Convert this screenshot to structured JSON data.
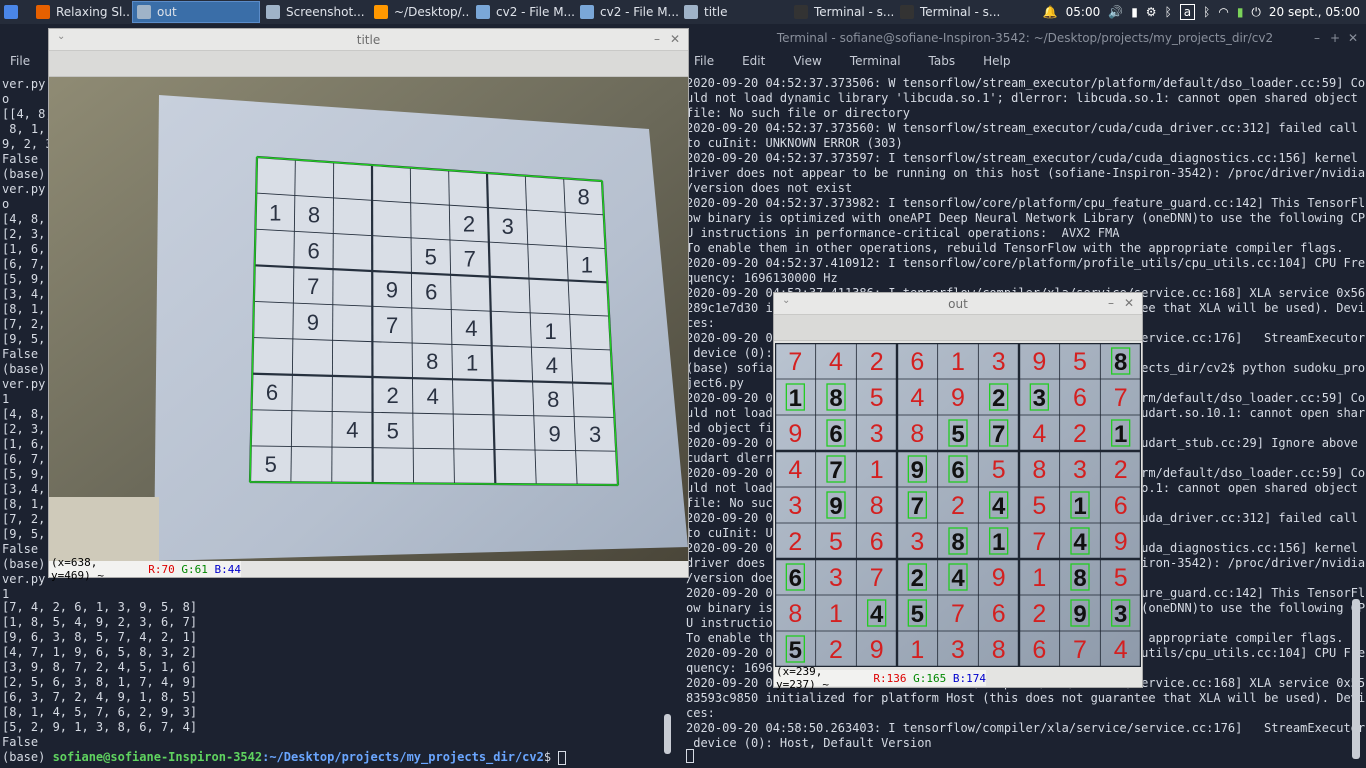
{
  "taskbar": {
    "tasks": [
      {
        "label": "",
        "icon": "app-menu-icon"
      },
      {
        "label": "Relaxing Sl...",
        "icon": "firefox-icon"
      },
      {
        "label": "out",
        "icon": "window-icon",
        "active": true
      },
      {
        "label": "Screenshot...",
        "icon": "window-icon"
      },
      {
        "label": "~/Desktop/...",
        "icon": "sublime-icon"
      },
      {
        "label": "cv2 - File M...",
        "icon": "folder-icon"
      },
      {
        "label": "cv2 - File M...",
        "icon": "folder-icon"
      },
      {
        "label": "title",
        "icon": "window-icon"
      },
      {
        "label": "Terminal - s...",
        "icon": "terminal-icon"
      },
      {
        "label": "Terminal - s...",
        "icon": "terminal-icon"
      }
    ],
    "time": "05:00",
    "date": "20 sept., 05:00"
  },
  "left_terminal": {
    "menu": [
      "File"
    ],
    "top_lines": [
      "ver.py",
      "o",
      "[[4, 8,",
      " 8, 1,",
      "9, 2, 3",
      "False",
      "(base)",
      "ver.py",
      "o",
      "[4, 8,",
      "[2, 3,",
      "[1, 6,",
      "[6, 7,",
      "[5, 9,",
      "[3, 4,",
      "[8, 1,",
      "[7, 2,",
      "[9, 5,",
      "False",
      "(base)",
      "ver.py",
      "1",
      "[4, 8,",
      "[2, 3,",
      "[1, 6,",
      "[6, 7,",
      "[5, 9,",
      "[3, 4,",
      "[8, 1,",
      "[7, 2,",
      "[9, 5,",
      "False",
      "(base)",
      "ver.py",
      "1"
    ],
    "bottom_lines": [
      "[7, 4, 2, 6, 1, 3, 9, 5, 8]",
      "[1, 8, 5, 4, 9, 2, 3, 6, 7]",
      "[9, 6, 3, 8, 5, 7, 4, 2, 1]",
      "[4, 7, 1, 9, 6, 5, 8, 3, 2]",
      "[3, 9, 8, 7, 2, 4, 5, 1, 6]",
      "[2, 5, 6, 3, 8, 1, 7, 4, 9]",
      "[6, 3, 7, 2, 4, 9, 1, 8, 5]",
      "[8, 1, 4, 5, 7, 6, 2, 9, 3]",
      "[5, 2, 9, 1, 3, 8, 6, 7, 4]",
      "False"
    ],
    "prompt_prefix": "(base) ",
    "prompt_user": "sofiane@sofiane-Inspiron-3542",
    "prompt_path": ":~/Desktop/projects/my_projects_dir/cv2",
    "prompt_suffix": "$ "
  },
  "title_window": {
    "title": "title",
    "status": {
      "coords": "(x=638, y=469) ~",
      "r": "R:70",
      "g": "G:61",
      "b": "B:44"
    },
    "puzzle": [
      [
        "",
        "",
        "",
        "",
        "",
        "",
        "",
        "",
        "8"
      ],
      [
        "1",
        "8",
        "",
        "",
        "",
        "2",
        "3",
        "",
        ""
      ],
      [
        "",
        "6",
        "",
        "",
        "5",
        "7",
        "",
        "",
        "1"
      ],
      [
        "",
        "7",
        "",
        "9",
        "6",
        "",
        "",
        "",
        ""
      ],
      [
        "",
        "9",
        "",
        "7",
        "",
        "4",
        "",
        "1",
        ""
      ],
      [
        "",
        "",
        "",
        "",
        "8",
        "1",
        "",
        "4",
        ""
      ],
      [
        "6",
        "",
        "",
        "2",
        "4",
        "",
        "",
        "8",
        ""
      ],
      [
        "",
        "",
        "4",
        "5",
        "",
        "",
        "",
        "9",
        "3"
      ],
      [
        "5",
        "",
        "",
        "",
        "",
        "",
        "",
        "",
        ""
      ]
    ]
  },
  "right_terminal": {
    "title": "Terminal - sofiane@sofiane-Inspiron-3542: ~/Desktop/projects/my_projects_dir/cv2",
    "menu": [
      "File",
      "Edit",
      "View",
      "Terminal",
      "Tabs",
      "Help"
    ],
    "lines": [
      "2020-09-20 04:52:37.373506: W tensorflow/stream_executor/platform/default/dso_loader.cc:59] Co",
      "uld not load dynamic library 'libcuda.so.1'; dlerror: libcuda.so.1: cannot open shared object",
      "file: No such file or directory",
      "2020-09-20 04:52:37.373560: W tensorflow/stream_executor/cuda/cuda_driver.cc:312] failed call",
      "to cuInit: UNKNOWN ERROR (303)",
      "2020-09-20 04:52:37.373597: I tensorflow/stream_executor/cuda/cuda_diagnostics.cc:156] kernel",
      "driver does not appear to be running on this host (sofiane-Inspiron-3542): /proc/driver/nvidia",
      "/version does not exist",
      "2020-09-20 04:52:37.373982: I tensorflow/core/platform/cpu_feature_guard.cc:142] This TensorFl",
      "ow binary is optimized with oneAPI Deep Neural Network Library (oneDNN)to use the following CP",
      "U instructions in performance-critical operations:  AVX2 FMA",
      "To enable them in other operations, rebuild TensorFlow with the appropriate compiler flags.",
      "2020-09-20 04:52:37.410912: I tensorflow/core/platform/profile_utils/cpu_utils.cc:104] CPU Fre",
      "quency: 1696130000 Hz",
      "2020-09-20 04:52:37.411386: I tensorflow/compiler/xla/service/service.cc:168] XLA service 0x56",
      "289c1e7d30 initialized for platform Host (this does not guarantee that XLA will be used). Devi",
      "ces:",
      "2020-09-20 04:52:37.411402: I tensorflow/compiler/xla/service/service.cc:176]   StreamExecutor",
      " device (0): Host, Default Version",
      "(base) sofiane@sofiane-Inspiron-3542:~/Desktop/projects/my_projects_dir/cv2$ python sudoku_pro",
      "ject6.py",
      "2020-09-20 04:58:50.100000: W tensorflow/stream_executor/platform/default/dso_loader.cc:59] Co",
      "uld not load dynamic library 'libcudart.so.10.1'; dlerror: libcudart.so.10.1: cannot open shar",
      "ed object file: No such file or directory",
      "2020-09-20 04:58:50.100000: I tensorflow/stream_executor/cuda/cudart_stub.cc:29] Ignore above",
      "cudart dlerror if you do not have a GPU set up on your machine.",
      "2020-09-20 04:58:50.200000: W tensorflow/stream_executor/platform/default/dso_loader.cc:59] Co",
      "uld not load dynamic library 'libcuda.so.1'; dlerror: libcuda.so.1: cannot open shared object",
      "file: No such file or directory",
      "2020-09-20 04:58:50.200000: W tensorflow/stream_executor/cuda/cuda_driver.cc:312] failed call",
      "to cuInit: UNKNOWN ERROR (303)",
      "2020-09-20 04:58:50.200000: I tensorflow/stream_executor/cuda/cuda_diagnostics.cc:156] kernel",
      "driver does not appear to be running on this host (sofiane-Inspiron-3542): /proc/driver/nvidia",
      "/version does not exist",
      "2020-09-20 04:58:50.200000: I tensorflow/core/platform/cpu_feature_guard.cc:142] This TensorFl",
      "ow binary is optimized with oneAPI Deep Neural Network Library (oneDNN)to use the following CP",
      "U instructions in performance-critical operations:  AVX2 FMA",
      "To enable them in other operations, rebuild TensorFlow with the appropriate compiler flags.",
      "2020-09-20 04:58:50.200000: I tensorflow/core/platform/profile_utils/cpu_utils.cc:104] CPU Fre",
      "quency: 1696130000 Hz",
      "2020-09-20 04:58:50.263392: I tensorflow/compiler/xla/service/service.cc:168] XLA service 0x55",
      "83593c9850 initialized for platform Host (this does not guarantee that XLA will be used). Devi",
      "ces:",
      "2020-09-20 04:58:50.263403: I tensorflow/compiler/xla/service/service.cc:176]   StreamExecutor",
      " device (0): Host, Default Version"
    ]
  },
  "out_window": {
    "title": "out",
    "status": {
      "coords": "(x=239, y=237) ~",
      "r": "R:136",
      "g": "G:165",
      "b": "B:174"
    },
    "solution": [
      [
        7,
        4,
        2,
        6,
        1,
        3,
        9,
        5,
        8
      ],
      [
        1,
        8,
        5,
        4,
        9,
        2,
        3,
        6,
        7
      ],
      [
        9,
        6,
        3,
        8,
        5,
        7,
        4,
        2,
        1
      ],
      [
        4,
        7,
        1,
        9,
        6,
        5,
        8,
        3,
        2
      ],
      [
        3,
        9,
        8,
        7,
        2,
        4,
        5,
        1,
        6
      ],
      [
        2,
        5,
        6,
        3,
        8,
        1,
        7,
        4,
        9
      ],
      [
        6,
        3,
        7,
        2,
        4,
        9,
        1,
        8,
        5
      ],
      [
        8,
        1,
        4,
        5,
        7,
        6,
        2,
        9,
        3
      ],
      [
        5,
        2,
        9,
        1,
        3,
        8,
        6,
        7,
        4
      ]
    ],
    "given_mask": [
      [
        0,
        0,
        0,
        0,
        0,
        0,
        0,
        0,
        1
      ],
      [
        1,
        1,
        0,
        0,
        0,
        1,
        1,
        0,
        0
      ],
      [
        0,
        1,
        0,
        0,
        1,
        1,
        0,
        0,
        1
      ],
      [
        0,
        1,
        0,
        1,
        1,
        0,
        0,
        0,
        0
      ],
      [
        0,
        1,
        0,
        1,
        0,
        1,
        0,
        1,
        0
      ],
      [
        0,
        0,
        0,
        0,
        1,
        1,
        0,
        1,
        0
      ],
      [
        1,
        0,
        0,
        1,
        1,
        0,
        0,
        1,
        0
      ],
      [
        0,
        0,
        1,
        1,
        0,
        0,
        0,
        1,
        1
      ],
      [
        1,
        0,
        0,
        0,
        0,
        0,
        0,
        0,
        0
      ]
    ]
  },
  "colors": {
    "solved": "#d42020",
    "given": "#111111",
    "grid_box": "#22cc22"
  }
}
